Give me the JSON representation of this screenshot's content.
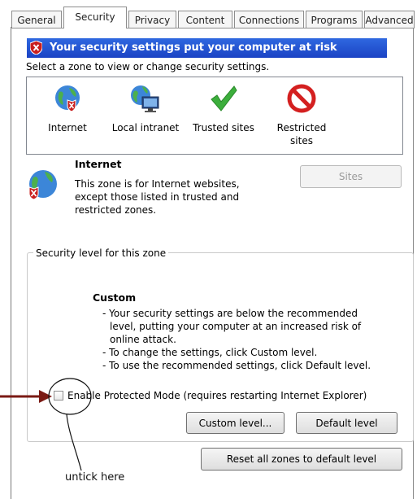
{
  "tabs": [
    "General",
    "Security",
    "Privacy",
    "Content",
    "Connections",
    "Programs",
    "Advanced"
  ],
  "active_tab": "Security",
  "warning": "Your security settings put your computer at risk",
  "select_prompt": "Select a zone to view or change security settings.",
  "zones": [
    {
      "label": "Internet",
      "icon": "internet-globe-warning-icon"
    },
    {
      "label": "Local intranet",
      "icon": "local-intranet-icon"
    },
    {
      "label": "Trusted sites",
      "icon": "checkmark-icon"
    },
    {
      "label": "Restricted\nsites",
      "icon": "restricted-icon"
    }
  ],
  "zone_info": {
    "title": "Internet",
    "desc_lines": [
      "This zone is for Internet websites,",
      "except those listed in trusted and",
      "restricted zones."
    ],
    "sites_button": "Sites"
  },
  "security_level": {
    "legend": "Security level for this zone",
    "title": "Custom",
    "lines": [
      "- Your security settings are below the recommended",
      "level, putting your computer at an increased risk of",
      "online attack.",
      "- To change the settings, click Custom level.",
      "- To use the recommended settings, click Default level."
    ],
    "protected_mode_label": "Enable Protected Mode (requires restarting Internet Explorer)",
    "protected_mode_checked": false,
    "custom_button": "Custom level...",
    "default_button": "Default level"
  },
  "reset_button": "Reset all zones to default level",
  "annotation": "untick here",
  "colors": {
    "warning_bar": "#1f4fd0",
    "arrow": "#7a1a14",
    "check_green": "#3cae3c",
    "restricted_red": "#d42020"
  }
}
